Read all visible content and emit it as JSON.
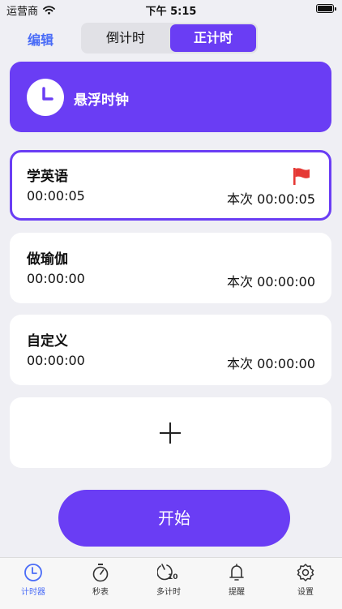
{
  "status": {
    "carrier": "运营商",
    "time": "下午 5:15"
  },
  "header": {
    "edit_label": "编辑",
    "tabs": [
      "倒计时",
      "正计时"
    ],
    "active_tab": "正计时"
  },
  "float_clock": {
    "label": "悬浮时钟"
  },
  "timers": [
    {
      "name": "学英语",
      "total": "00:00:05",
      "lap": "本次 00:00:05",
      "flagged": true
    },
    {
      "name": "做瑜伽",
      "total": "00:00:00",
      "lap": "本次 00:00:00"
    },
    {
      "name": "自定义",
      "total": "00:00:00",
      "lap": "本次 00:00:00"
    }
  ],
  "start_label": "开始",
  "tabbar": [
    {
      "label": "计时器",
      "icon": "clock-icon",
      "active": true
    },
    {
      "label": "秒表",
      "icon": "stopwatch-icon"
    },
    {
      "label": "多计时",
      "icon": "multi-timer-icon",
      "badge": "10"
    },
    {
      "label": "提醒",
      "icon": "bell-icon"
    },
    {
      "label": "设置",
      "icon": "gear-icon"
    }
  ],
  "colors": {
    "accent": "#6a3df4",
    "link": "#4a6cf7",
    "flag": "#e53935",
    "background": "#efeff4"
  }
}
